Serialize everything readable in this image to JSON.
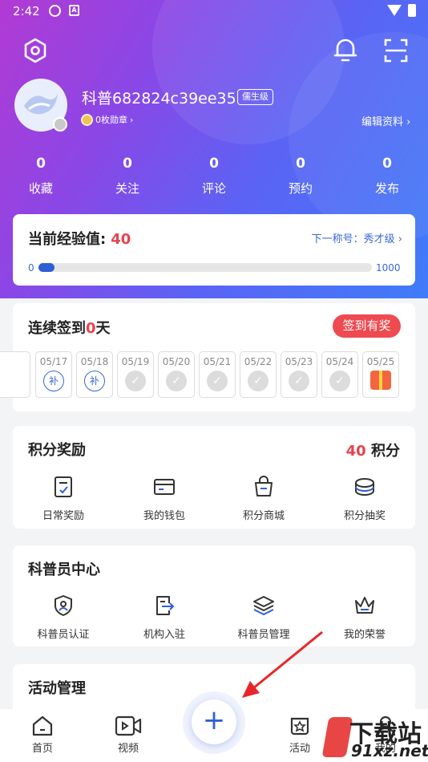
{
  "status_bar": {
    "time": "2:42"
  },
  "profile": {
    "username": "科普682824c39ee35",
    "level_tag": "儒生级",
    "medals": "0枚勋章",
    "edit_profile": "编辑资料"
  },
  "stats": [
    {
      "value": "0",
      "label": "收藏"
    },
    {
      "value": "0",
      "label": "关注"
    },
    {
      "value": "0",
      "label": "评论"
    },
    {
      "value": "0",
      "label": "预约"
    },
    {
      "value": "0",
      "label": "发布"
    }
  ],
  "experience": {
    "label": "当前经验值:",
    "value": "40",
    "next_title": "下一称号：秀才级",
    "min": "0",
    "max": "1000",
    "progress_fraction": 0.04
  },
  "checkin": {
    "title_prefix": "连续签到",
    "days_count": "0",
    "title_suffix": "天",
    "reward_button": "签到有奖",
    "days": [
      {
        "date": "05/17",
        "state": "makeup",
        "icon_text": "补"
      },
      {
        "date": "05/18",
        "state": "makeup",
        "icon_text": "补"
      },
      {
        "date": "05/19",
        "state": "future"
      },
      {
        "date": "05/20",
        "state": "future"
      },
      {
        "date": "05/21",
        "state": "future"
      },
      {
        "date": "05/22",
        "state": "future"
      },
      {
        "date": "05/23",
        "state": "future"
      },
      {
        "date": "05/24",
        "state": "future"
      },
      {
        "date": "05/25",
        "state": "gift"
      }
    ]
  },
  "points": {
    "title": "积分奖励",
    "total": "40",
    "unit": "积分",
    "features": [
      {
        "label": "日常奖励",
        "icon": "daily-reward-icon"
      },
      {
        "label": "我的钱包",
        "icon": "wallet-icon"
      },
      {
        "label": "积分商城",
        "icon": "shop-bag-icon"
      },
      {
        "label": "积分抽奖",
        "icon": "lottery-icon"
      }
    ]
  },
  "science_center": {
    "title": "科普员中心",
    "features": [
      {
        "label": "科普员认证",
        "icon": "certification-shield-icon"
      },
      {
        "label": "机构入驻",
        "icon": "institution-enter-icon"
      },
      {
        "label": "科普员管理",
        "icon": "layers-icon"
      },
      {
        "label": "我的荣誉",
        "icon": "crown-icon"
      }
    ]
  },
  "activity": {
    "title": "活动管理"
  },
  "tabbar": {
    "items": [
      {
        "label": "首页",
        "icon": "home-icon"
      },
      {
        "label": "视频",
        "icon": "video-icon"
      },
      {
        "label": "活动",
        "icon": "activity-icon"
      },
      {
        "label": "我的",
        "icon": "profile-icon"
      }
    ],
    "fab_icon": "plus-icon"
  },
  "watermark": {
    "line1": "下载站",
    "line2": "91xz.net"
  },
  "colors": {
    "accent_blue": "#2f5fd6",
    "accent_red": "#e8424f"
  }
}
